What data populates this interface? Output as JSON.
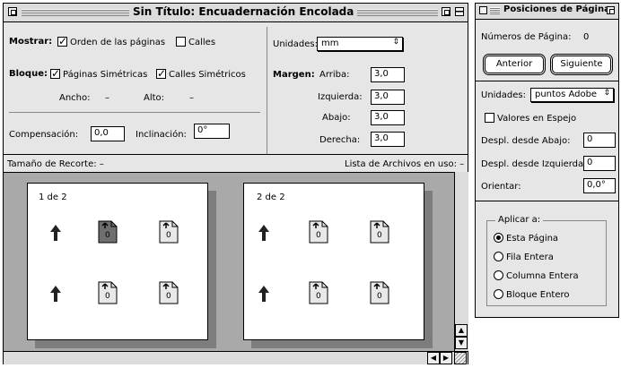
{
  "main": {
    "title": "Sin Título: Encuadernación Encolada",
    "mostrar_label": "Mostrar:",
    "orden_label": "Orden de las páginas",
    "orden_checked": true,
    "calles_label": "Calles",
    "calles_checked": false,
    "bloque_label": "Bloque:",
    "pag_sim_label": "Páginas Simétricas",
    "pag_sim_checked": true,
    "calles_sim_label": "Calles Simétricos",
    "calles_sim_checked": true,
    "ancho_label": "Ancho:",
    "ancho_value": "–",
    "alto_label": "Alto:",
    "alto_value": "–",
    "compensacion_label": "Compensación:",
    "compensacion_value": "0,0",
    "inclinacion_label": "Inclinación:",
    "inclinacion_value": "0°",
    "unidades_label": "Unidades:",
    "unidades_value": "mm",
    "margen_label": "Margen:",
    "arriba_label": "Arriba:",
    "arriba_value": "3,0",
    "izquierda_label": "Izquierda:",
    "izquierda_value": "3,0",
    "abajo_label": "Abajo:",
    "abajo_value": "3,0",
    "derecha_label": "Derecha:",
    "derecha_value": "3,0",
    "recorte_label": "Tamaño de Recorte: –",
    "archivos_label": "Lista de Archivos en uso: –",
    "spreads": [
      {
        "label": "1 de 2",
        "pages": [
          "0",
          "0",
          "0",
          "0"
        ]
      },
      {
        "label": "2 de 2",
        "pages": [
          "0",
          "0",
          "0",
          "0"
        ]
      }
    ]
  },
  "palette": {
    "title": "Posiciones de Página",
    "num_pag_label": "Números de Página:",
    "num_pag_value": "0",
    "anterior_label": "Anterior",
    "siguiente_label": "Siguiente",
    "unidades_label": "Unidades:",
    "unidades_value": "puntos Adobe",
    "espejo_label": "Valores en Espejo",
    "espejo_checked": false,
    "despl_abajo_label": "Despl. desde Abajo:",
    "despl_abajo_value": "0",
    "despl_izq_label": "Despl. desde Izquierda:",
    "despl_izq_value": "0",
    "orientar_label": "Orientar:",
    "orientar_value": "0,0°",
    "aplicar_label": "Aplicar a:",
    "options": [
      "Esta Página",
      "Fila Entera",
      "Columna Entera",
      "Bloque Entero"
    ],
    "selected_option": "Esta Página"
  },
  "colors": {
    "window_bg": "#e6e6e6",
    "canvas_bg": "#a9a9a9",
    "selected_page": "#6f6f6f"
  }
}
